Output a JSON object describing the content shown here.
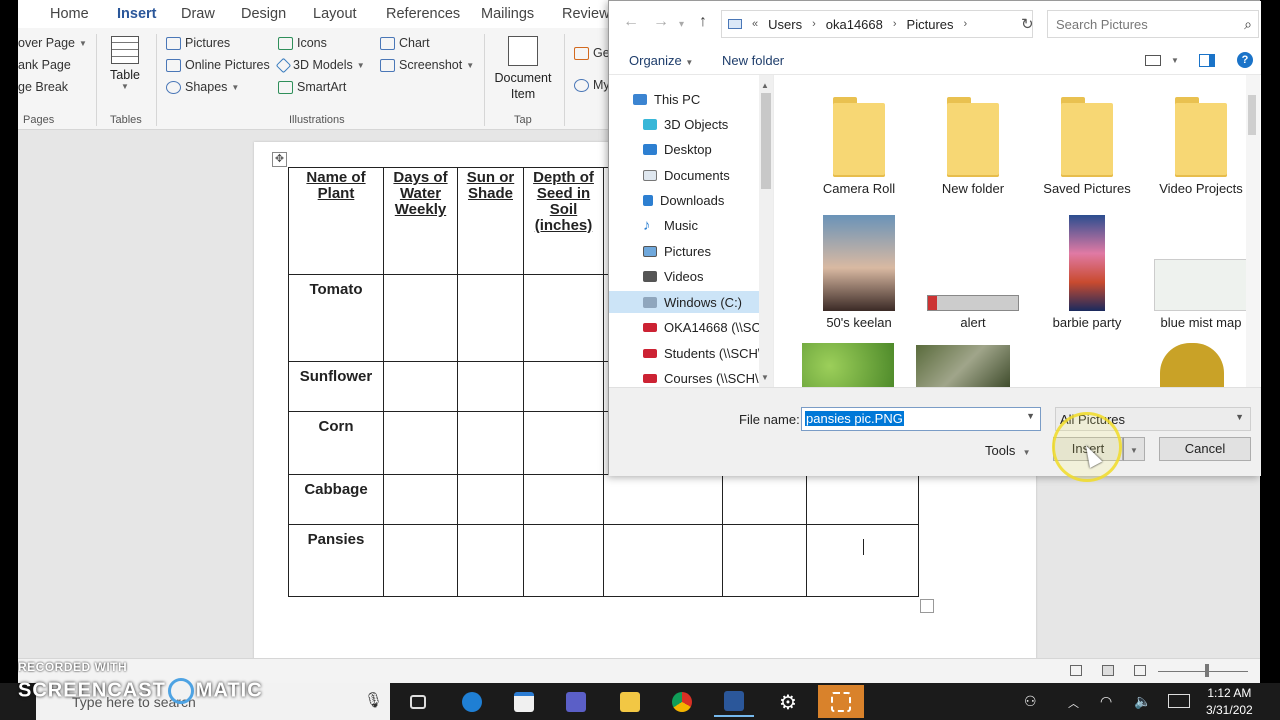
{
  "word": {
    "tabs": [
      "Home",
      "Insert",
      "Draw",
      "Design",
      "Layout",
      "References",
      "Mailings",
      "Review"
    ],
    "active_tab": "Insert",
    "ribbon": {
      "pages_items": [
        "over Page",
        "ank Page",
        "ge Break"
      ],
      "pages_label": "Pages",
      "table_label": "Table",
      "tables_label": "Tables",
      "pictures": "Pictures",
      "online_pictures": "Online Pictures",
      "shapes": "Shapes",
      "icons": "Icons",
      "models_3d": "3D Models",
      "smartart": "SmartArt",
      "chart": "Chart",
      "screenshot": "Screenshot",
      "illustrations_label": "Illustrations",
      "document_item": "Document Item",
      "tap_label": "Tap",
      "get_addins": "Ge",
      "my_addins": "My"
    },
    "table": {
      "headers": [
        "Name of Plant",
        "Days of Water Weekly",
        "Sun or Shade",
        "Depth of Seed in Soil (inches)",
        "",
        "",
        ""
      ],
      "rows": [
        "Tomato",
        "Sunflower",
        "Corn",
        "Cabbage",
        "Pansies"
      ]
    }
  },
  "dialog": {
    "breadcrumb": [
      "Users",
      "oka14668",
      "Pictures"
    ],
    "search_placeholder": "Search Pictures",
    "organize": "Organize",
    "new_folder": "New folder",
    "help": "?",
    "nav": [
      "This PC",
      "3D Objects",
      "Desktop",
      "Documents",
      "Downloads",
      "Music",
      "Pictures",
      "Videos",
      "Windows (C:)",
      "OKA14668 (\\\\SC",
      "Students (\\\\SCH\\",
      "Courses (\\\\SCH\\"
    ],
    "selected_nav": "Windows (C:)",
    "files": [
      "Camera Roll",
      "New folder",
      "Saved Pictures",
      "Video Projects",
      "50's keelan",
      "alert",
      "barbie party",
      "blue mist map"
    ],
    "file_name_label": "File name:",
    "file_name_value": "pansies pic.PNG",
    "filter_value": "All Pictures",
    "tools": "Tools",
    "insert": "Insert",
    "cancel": "Cancel"
  },
  "taskbar": {
    "search_placeholder": "Type here to search",
    "time": "1:12 AM",
    "date": "3/31/202"
  },
  "watermark": {
    "recorded_with": "RECORDED WITH",
    "brand_left": "SCREENCAST",
    "brand_right": "MATIC"
  }
}
